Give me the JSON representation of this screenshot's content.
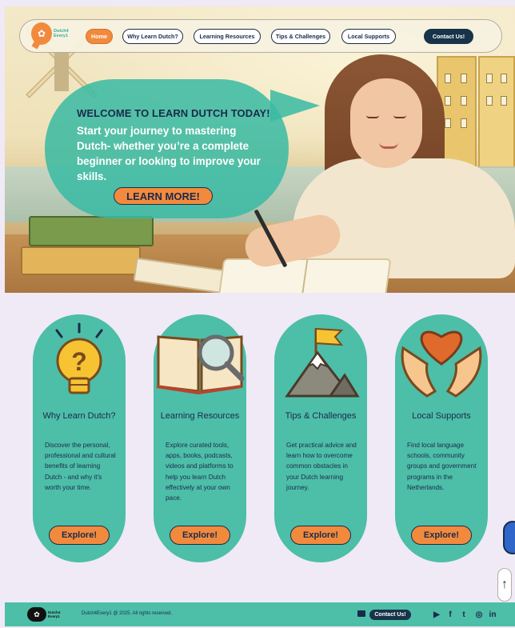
{
  "nav": {
    "logo_line1": "Dutch4",
    "logo_line2": "Every1",
    "items": [
      {
        "label": "Home"
      },
      {
        "label": "Why Learn Dutch?"
      },
      {
        "label": "Learning Resources"
      },
      {
        "label": "Tips & Challenges"
      },
      {
        "label": "Local Supports"
      }
    ],
    "contact_label": "Contact Us!"
  },
  "hero": {
    "title": "WELCOME TO LEARN DUTCH TODAY!",
    "text": "Start your journey to mastering Dutch- whether you’re a complete beginner or looking to improve your skills.",
    "button": "LEARN MORE!"
  },
  "cards": [
    {
      "icon": "lightbulb-icon",
      "title": "Why Learn Dutch?",
      "text": "Discover the personal, professional and cultural benefits of learning Dutch - and why it's worth your time.",
      "button": "Explore!"
    },
    {
      "icon": "book-magnifier-icon",
      "title": "Learning Resources",
      "text": "Explore curated tools, apps, books, podcasts, videos and platforms to help you learn Dutch effectively at your own pace.",
      "button": "Explore!"
    },
    {
      "icon": "mountain-flag-icon",
      "title": "Tips & Challenges",
      "text": "Get practical advice and learn how to overcome common obstacles in your Dutch learning journey.",
      "button": "Explore!"
    },
    {
      "icon": "hands-heart-icon",
      "title": "Local Supports",
      "text": "Find local language schools, community groups and government programs in the Netherlands.",
      "button": "Explore!"
    }
  ],
  "footer": {
    "logo_line1": "Dutch4",
    "logo_line2": "Every1",
    "copyright": "Dutch4Every1 @ 2025. All rights reserved.",
    "contact_label": "Contact Us!",
    "social": [
      "youtube-icon",
      "facebook-icon",
      "twitter-icon",
      "instagram-icon",
      "linkedin-icon"
    ]
  },
  "colors": {
    "accent_orange": "#f28a3d",
    "teal": "#4dbea8",
    "navy": "#1b2a4a"
  }
}
